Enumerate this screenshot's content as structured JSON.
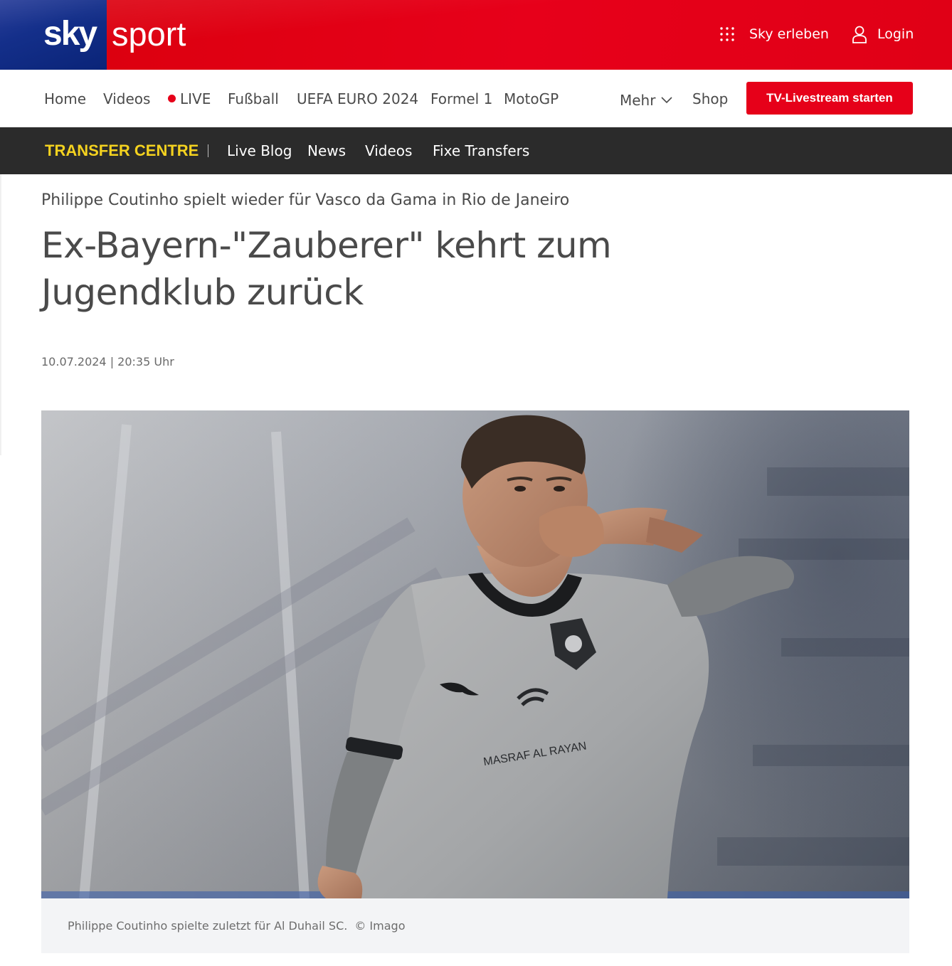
{
  "header": {
    "logo": {
      "sky": "sky",
      "sport": "sport"
    },
    "actions": {
      "erleben_label": "Sky erleben",
      "login_label": "Login"
    },
    "colors": {
      "brand_red": "#e60019",
      "brand_blue": "#0a2478"
    }
  },
  "nav": {
    "items": [
      {
        "label": "Home"
      },
      {
        "label": "Videos"
      },
      {
        "label": "LIVE"
      },
      {
        "label": "Fußball"
      },
      {
        "label": "UEFA EURO 2024"
      },
      {
        "label": "Formel 1"
      },
      {
        "label": "MotoGP"
      }
    ],
    "more_label": "Mehr",
    "shop_label": "Shop",
    "cta_label": "TV-Livestream starten"
  },
  "transfer": {
    "title": "TRANSFER CENTRE",
    "items": [
      {
        "label": "Live Blog"
      },
      {
        "label": "News"
      },
      {
        "label": "Videos"
      },
      {
        "label": "Fixe Transfers"
      }
    ],
    "colors": {
      "title": "#f4d21f",
      "bar": "#2b2b2b"
    }
  },
  "article": {
    "kicker": "Philippe Coutinho spielt wieder für Vasco da Gama in Rio de Janeiro",
    "headline": "Ex-Bayern-\"Zauberer\" kehrt zum Jugendklub zurück",
    "date": "10.07.2024 | 20:35 Uhr",
    "image": {
      "caption": "Philippe Coutinho spielte zuletzt für Al Duhail SC.",
      "credit": "© Imago",
      "shirt_sponsor": "MASRAF AL RAYAN"
    }
  }
}
